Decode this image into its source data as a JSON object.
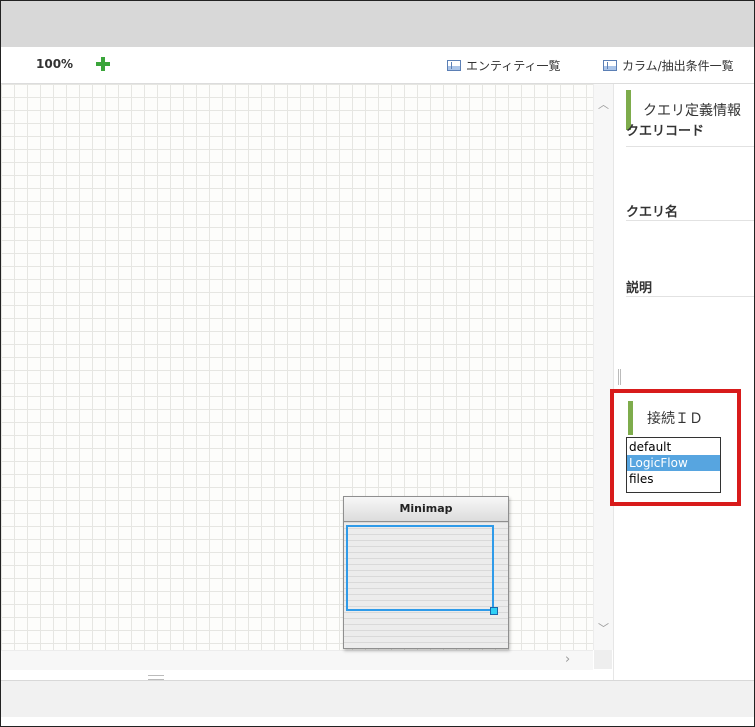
{
  "toolbar": {
    "zoom": "100%",
    "add_icon": "plus-icon",
    "entity_list_label": "エンティティ一覧",
    "column_list_label": "カラム/抽出条件一覧"
  },
  "right_panel": {
    "section_title": "クエリ定義情報",
    "fields": {
      "query_code_label": "クエリコード",
      "query_name_label": "クエリ名",
      "description_label": "説明"
    },
    "connection": {
      "title": "接続ＩＤ",
      "options": [
        "default",
        "LogicFlow",
        "files"
      ],
      "selected": "LogicFlow"
    }
  },
  "minimap": {
    "title": "Minimap"
  },
  "colors": {
    "accent_green": "#7eac4c",
    "highlight_red": "#d81b1b",
    "selection_blue": "#57a5e0",
    "viewport_blue": "#2f9be9"
  }
}
